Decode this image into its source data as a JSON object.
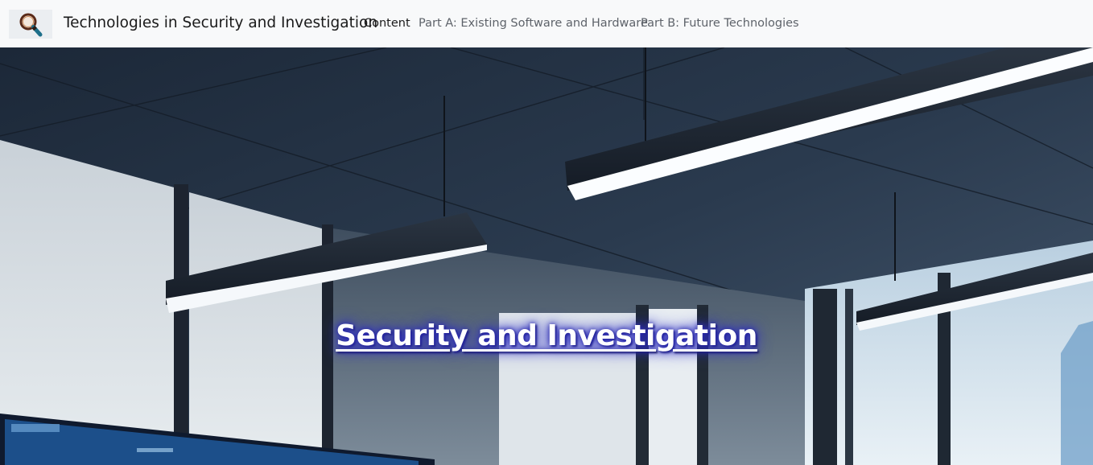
{
  "navbar": {
    "logo_icon": "magnifier-icon",
    "brand_title": "Technologies in Security and Investigation",
    "links": [
      {
        "label": "Content",
        "active": true
      },
      {
        "label": "Part A: Existing Software and Hardware",
        "active": false
      },
      {
        "label": "Part B: Future Technologies",
        "active": false
      }
    ]
  },
  "hero": {
    "title": "Security and Investigation",
    "background_description_icon": "office-ceiling-lights-photo",
    "title_glow_color": "#3030c0"
  }
}
